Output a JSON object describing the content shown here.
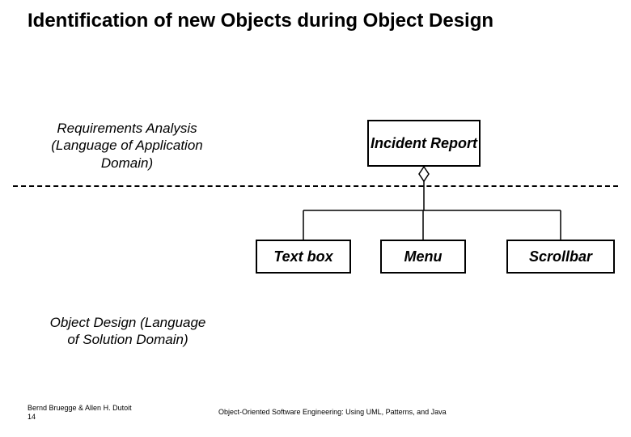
{
  "title": "Identification of new Objects during Object Design",
  "labels": {
    "requirements": "Requirements Analysis (Language of Application Domain)",
    "objectdesign": "Object Design (Language of Solution Domain)"
  },
  "boxes": {
    "incident": "Incident Report",
    "textbox": "Text box",
    "menu": "Menu",
    "scrollbar": "Scrollbar"
  },
  "footer": {
    "authors": "Bernd Bruegge & Allen H. Dutoit",
    "page": "14",
    "book": "Object-Oriented Software Engineering: Using UML, Patterns, and Java"
  }
}
